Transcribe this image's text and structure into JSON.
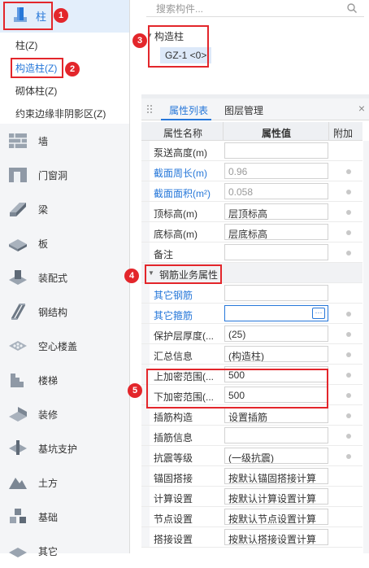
{
  "left_panel": {
    "active_category": {
      "label": "柱",
      "icon": "column-icon"
    },
    "subcategories": [
      {
        "label": "柱(Z)",
        "selected": false
      },
      {
        "label": "构造柱(Z)",
        "selected": true
      },
      {
        "label": "砌体柱(Z)",
        "selected": false
      },
      {
        "label": "约束边缘非阴影区(Z)",
        "selected": false
      }
    ],
    "categories": [
      {
        "label": "墙",
        "icon": "wall-icon"
      },
      {
        "label": "门窗洞",
        "icon": "door-window-icon"
      },
      {
        "label": "梁",
        "icon": "beam-icon"
      },
      {
        "label": "板",
        "icon": "slab-icon"
      },
      {
        "label": "装配式",
        "icon": "prefab-icon"
      },
      {
        "label": "钢结构",
        "icon": "steel-structure-icon"
      },
      {
        "label": "空心楼盖",
        "icon": "hollow-floor-icon"
      },
      {
        "label": "楼梯",
        "icon": "stair-icon"
      },
      {
        "label": "装修",
        "icon": "decoration-icon"
      },
      {
        "label": "基坑支护",
        "icon": "pit-support-icon"
      },
      {
        "label": "土方",
        "icon": "earthwork-icon"
      },
      {
        "label": "基础",
        "icon": "foundation-icon"
      },
      {
        "label": "其它",
        "icon": "other-icon"
      }
    ]
  },
  "search": {
    "placeholder": "搜索构件..."
  },
  "component_tree": {
    "group_label": "构造柱",
    "items": [
      {
        "label": "GZ-1 <0>"
      }
    ]
  },
  "property_panel": {
    "tabs": [
      {
        "label": "属性列表",
        "active": true
      },
      {
        "label": "图层管理",
        "active": false
      }
    ],
    "close_symbol": "×",
    "headers": {
      "name": "属性名称",
      "value": "属性值",
      "extra": "附加"
    },
    "rows_top": [
      {
        "name": "泵送高度(m)",
        "value": "",
        "style": "normal",
        "has_dot": false
      },
      {
        "name": "截面周长(m)",
        "value": "0.96",
        "style": "blue",
        "has_dot": true,
        "value_gray": true
      },
      {
        "name": "截面面积(m²)",
        "value": "0.058",
        "style": "blue",
        "has_dot": true,
        "value_gray": true
      },
      {
        "name": "顶标高(m)",
        "value": "层顶标高",
        "style": "normal",
        "has_dot": true
      },
      {
        "name": "底标高(m)",
        "value": "层底标高",
        "style": "normal",
        "has_dot": true
      },
      {
        "name": "备注",
        "value": "",
        "style": "normal",
        "has_dot": true
      }
    ],
    "group": {
      "label": "钢筋业务属性"
    },
    "rows_bottom": [
      {
        "name": "其它钢筋",
        "value": "",
        "style": "blue",
        "has_dot": false
      },
      {
        "name": "其它箍筋",
        "value": "",
        "style": "blue",
        "has_dot": true,
        "ellipsis": "···"
      },
      {
        "name": "保护层厚度(...",
        "value": "(25)",
        "style": "normal",
        "has_dot": true
      },
      {
        "name": "汇总信息",
        "value": "(构造柱)",
        "style": "normal",
        "has_dot": true
      },
      {
        "name": "上加密范围(...",
        "value": "500",
        "style": "normal",
        "has_dot": true
      },
      {
        "name": "下加密范围(...",
        "value": "500",
        "style": "normal",
        "has_dot": true
      },
      {
        "name": "插筋构造",
        "value": "设置插筋",
        "style": "normal",
        "has_dot": true
      },
      {
        "name": "插筋信息",
        "value": "",
        "style": "normal",
        "has_dot": true
      },
      {
        "name": "抗震等级",
        "value": "(一级抗震)",
        "style": "normal",
        "has_dot": true
      },
      {
        "name": "锚固搭接",
        "value": "按默认锚固搭接计算",
        "style": "normal",
        "has_dot": false
      },
      {
        "name": "计算设置",
        "value": "按默认计算设置计算",
        "style": "normal",
        "has_dot": false
      },
      {
        "name": "节点设置",
        "value": "按默认节点设置计算",
        "style": "normal",
        "has_dot": false
      },
      {
        "name": "搭接设置",
        "value": "按默认搭接设置计算",
        "style": "normal",
        "has_dot": false
      }
    ]
  },
  "annotations": [
    "1",
    "2",
    "3",
    "4",
    "5"
  ],
  "colors": {
    "accent": "#2677d9",
    "highlight": "#e3262b",
    "selected_bg": "#e3eefb"
  }
}
